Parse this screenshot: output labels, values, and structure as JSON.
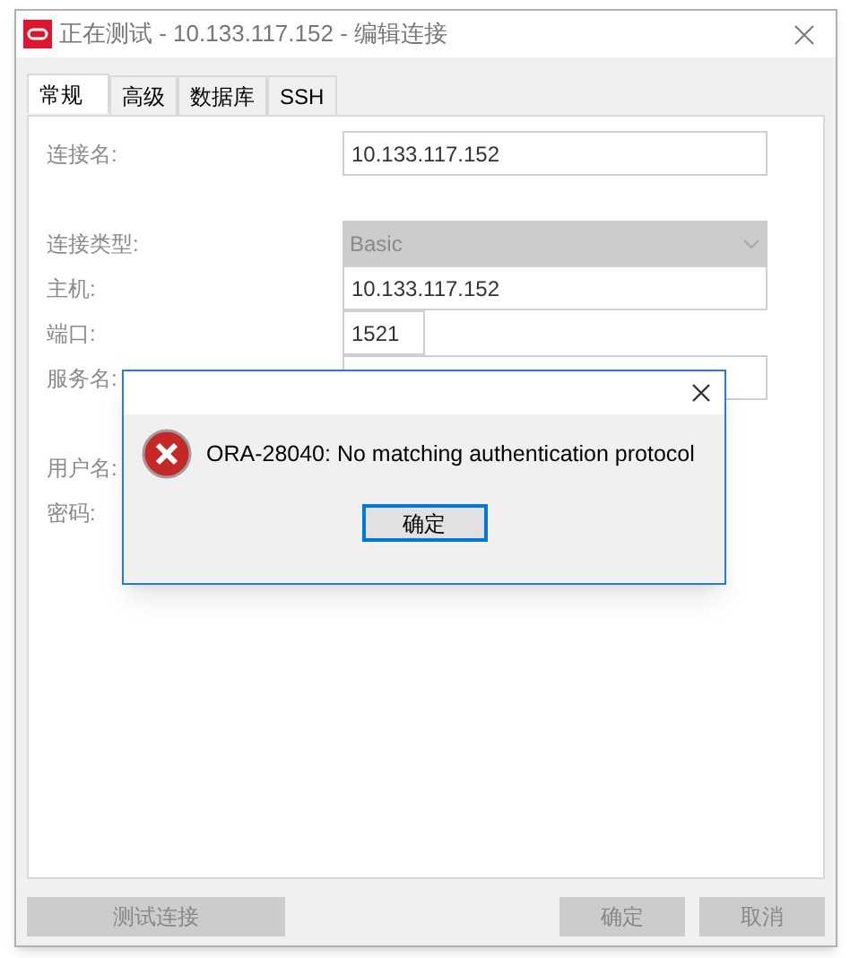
{
  "window": {
    "title": "正在测试 - 10.133.117.152 - 编辑连接"
  },
  "tabs": [
    {
      "label": "常规",
      "selected": true
    },
    {
      "label": "高级",
      "selected": false
    },
    {
      "label": "数据库",
      "selected": false
    },
    {
      "label": "SSH",
      "selected": false
    }
  ],
  "form": [
    {
      "kind": "text",
      "label": "连接名:",
      "value": "10.133.117.152"
    },
    {
      "kind": "gap"
    },
    {
      "kind": "select",
      "label": "连接类型:",
      "value": "Basic",
      "disabled": true
    },
    {
      "kind": "text",
      "label": "主机:",
      "value": "10.133.117.152"
    },
    {
      "kind": "short",
      "label": "端口:",
      "value": "1521"
    },
    {
      "kind": "text",
      "label": "服务名:"
    },
    {
      "kind": "gap"
    },
    {
      "kind": "label",
      "label": "用户名:"
    },
    {
      "kind": "label",
      "label": "密码:"
    }
  ],
  "buttons": [
    {
      "label": "测试连接",
      "disabled": true
    },
    {
      "label": "确定",
      "disabled": true
    },
    {
      "label": "取消",
      "disabled": true
    }
  ],
  "dialog": {
    "message": "ORA-28040: No matching authentication protocol",
    "button": "确定"
  }
}
